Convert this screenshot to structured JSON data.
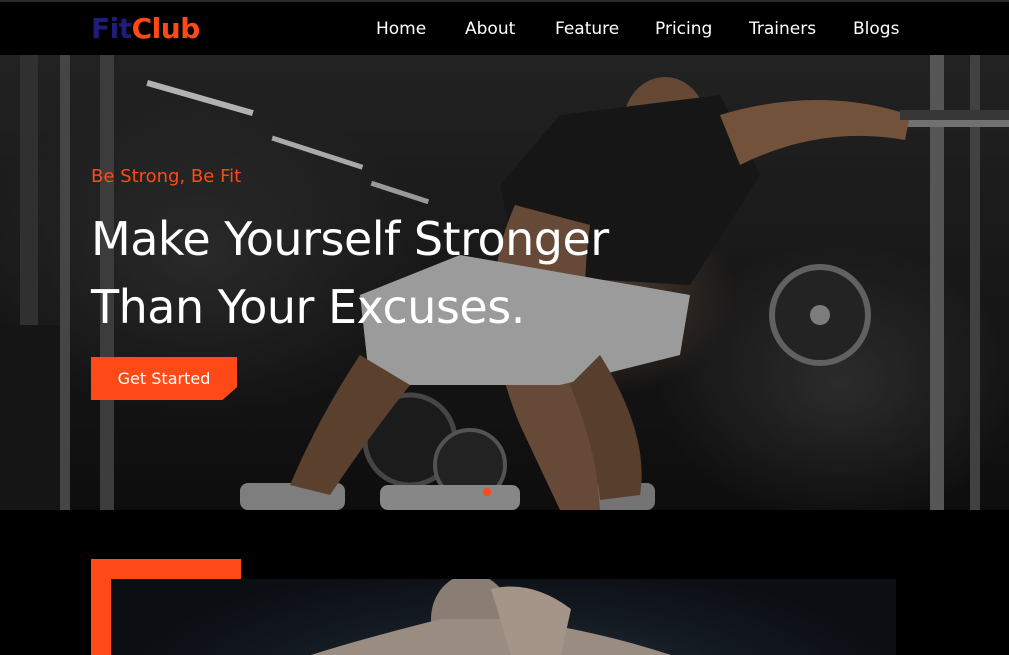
{
  "brand": {
    "part1": "Fit",
    "part2": "Club"
  },
  "nav": {
    "items": [
      {
        "label": "Home"
      },
      {
        "label": "About"
      },
      {
        "label": "Feature"
      },
      {
        "label": "Pricing"
      },
      {
        "label": "Trainers"
      },
      {
        "label": "Blogs"
      }
    ]
  },
  "hero": {
    "tagline": "Be Strong, Be Fit",
    "headline_line1": "Make Yourself Stronger",
    "headline_line2": "Than Your Excuses.",
    "cta_label": "Get Started",
    "active_slide": 1
  },
  "colors": {
    "accent": "#ff4a17",
    "brand_dark": "#1e1e7a",
    "background": "#000000",
    "text": "#ffffff"
  }
}
